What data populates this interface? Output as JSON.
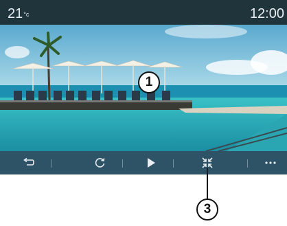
{
  "status": {
    "temperature": "21",
    "temperature_unit": "°c",
    "time": "12:00"
  },
  "photo": {
    "icon": "beach-resort-image"
  },
  "controls": {
    "back_icon": "back-arrow-icon",
    "rotate_icon": "rotate-icon",
    "play_icon": "play-icon",
    "fullscreen_icon": "fullscreen-toggle-icon",
    "more_icon": "more-options-icon"
  },
  "callouts": [
    {
      "label": "1"
    },
    {
      "label": "3"
    }
  ],
  "colors": {
    "sea": "#2fb3b4",
    "sky": "#6fb9d3",
    "controls_bar": "#142837"
  }
}
